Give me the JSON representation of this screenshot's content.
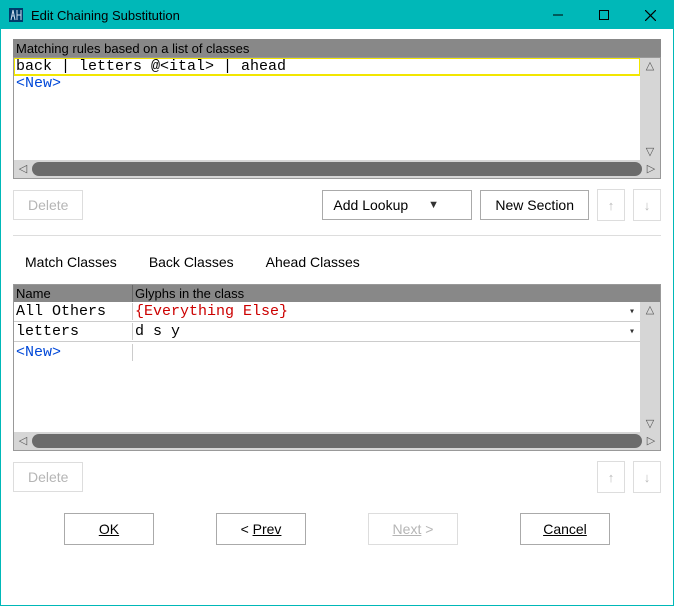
{
  "window": {
    "title": "Edit Chaining Substitution"
  },
  "rules": {
    "header": "Matching rules based on a list of classes",
    "selected": "back | letters @<ital> | ahead",
    "new_label": "<New>"
  },
  "toolbar1": {
    "delete_label": "Delete",
    "add_lookup_label": "Add Lookup",
    "new_section_label": "New Section"
  },
  "tabs": {
    "match": "Match Classes",
    "back": "Back Classes",
    "ahead": "Ahead Classes"
  },
  "classes": {
    "col_name": "Name",
    "col_glyph": "Glyphs in the class",
    "rows": [
      {
        "name": "All Others",
        "glyphs": "{Everything Else}",
        "special": true
      },
      {
        "name": "letters",
        "glyphs": "d s y",
        "special": false
      }
    ],
    "new_label": "<New>"
  },
  "toolbar2": {
    "delete_label": "Delete"
  },
  "footer": {
    "ok": "OK",
    "prev": "Prev",
    "next": "Next",
    "cancel": "Cancel"
  }
}
